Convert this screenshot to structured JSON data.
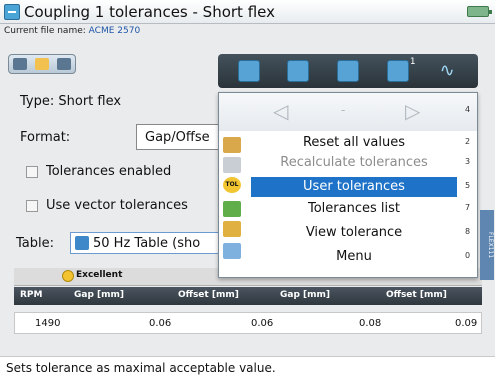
{
  "window": {
    "title": "Coupling 1 tolerances - Short flex"
  },
  "file": {
    "label": "Current file name:",
    "name": "ACME 2570"
  },
  "form": {
    "type_line": "Type: Short flex",
    "format_label": "Format:",
    "format_value": "Gap/Offse",
    "tolerances_enabled": "Tolerances enabled",
    "use_vector": "Use vector tolerances",
    "table_label": "Table:",
    "table_value": "50 Hz Table (sho"
  },
  "grid": {
    "band_label": "Excellent",
    "headers": [
      "RPM",
      "Gap [mm]",
      "Offset [mm]",
      "Gap [mm]",
      "Offset [mm]"
    ],
    "rows": [
      {
        "rpm": "1490",
        "gap1": "0.06",
        "off1": "0.06",
        "gap2": "0.08",
        "off2": "0.09"
      }
    ]
  },
  "toolbar": {
    "superscript": "1"
  },
  "context_menu": {
    "nav_dash": "-",
    "items": [
      {
        "label": "Reset all values",
        "key": "2"
      },
      {
        "label": "Recalculate tolerances",
        "key": "3"
      },
      {
        "label": "User tolerances",
        "key": "5"
      },
      {
        "label": "Tolerances list",
        "key": "7"
      },
      {
        "label": "View tolerance",
        "key": "8"
      },
      {
        "label": "Menu",
        "key": "0"
      }
    ],
    "top_key": "4",
    "tol_badge": "TOL",
    "side_tab_text": "FLEX111"
  },
  "status": {
    "text": "Sets tolerance as maximal acceptable value."
  },
  "colors": {
    "accent": "#1e73c8",
    "toolbar": "#2a3339",
    "battery": "#7fb58a"
  }
}
